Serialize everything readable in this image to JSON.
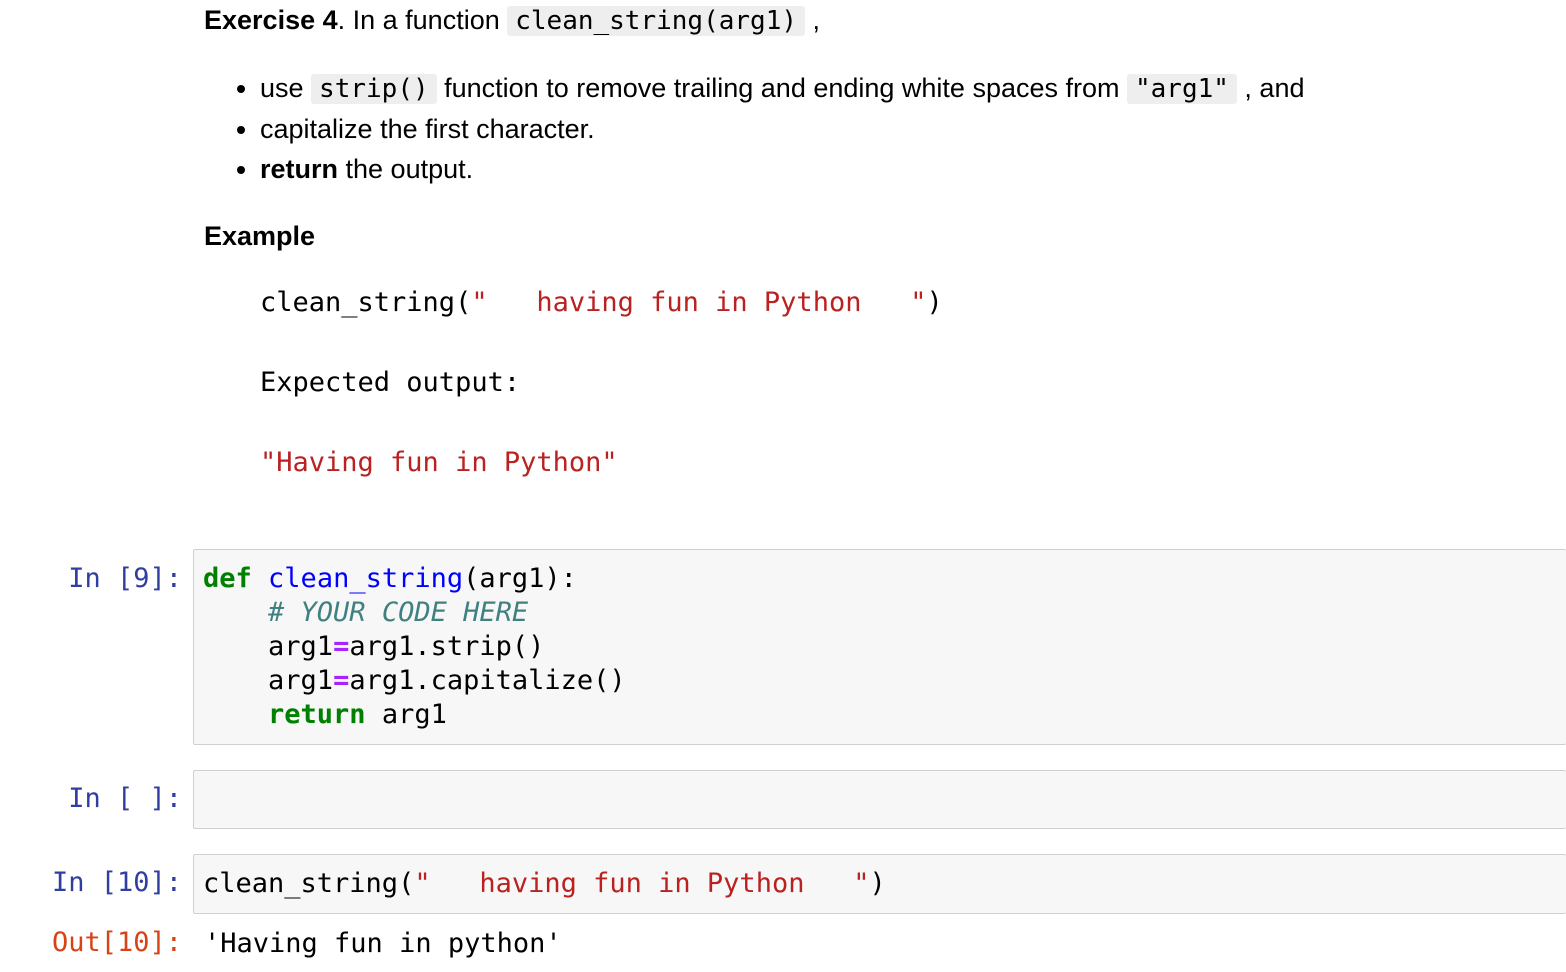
{
  "exercise": {
    "title_bold": "Exercise 4",
    "title_rest": ". In a function ",
    "title_code": "clean_string(arg1)",
    "title_tail": " ,",
    "bullets": [
      {
        "pre": "use ",
        "code1": "strip()",
        "mid": " function to remove trailing and ending white spaces from ",
        "code2": "\"arg1\"",
        "post": " , and"
      },
      {
        "text": "capitalize the first character."
      },
      {
        "bold": "return",
        "text": " the output."
      }
    ],
    "example_heading": "Example",
    "example_call_fn": "clean_string(",
    "example_call_str": "\"   having fun in Python   \"",
    "example_call_close": ")",
    "expected_label": "Expected output:",
    "expected_value": "\"Having fun in Python\""
  },
  "cells": [
    {
      "prompt": "In [9]:",
      "lines": {
        "l1_kw": "def",
        "l1_fn": "clean_string",
        "l1_rest": "(arg1):",
        "l2_comment": "# YOUR CODE HERE",
        "l3_var": "arg1",
        "l3_op": "=",
        "l3_rest": "arg1.strip()",
        "l4_var": "arg1",
        "l4_op": "=",
        "l4_rest": "arg1.capitalize()",
        "l5_kw": "return",
        "l5_rest": " arg1"
      }
    },
    {
      "prompt": "In [ ]:"
    },
    {
      "prompt": "In [10]:",
      "call_fn": "clean_string(",
      "call_str": "\"   having fun in Python   \"",
      "call_close": ")"
    }
  ],
  "output": {
    "prompt": "Out[10]:",
    "value": "'Having fun in python'"
  }
}
